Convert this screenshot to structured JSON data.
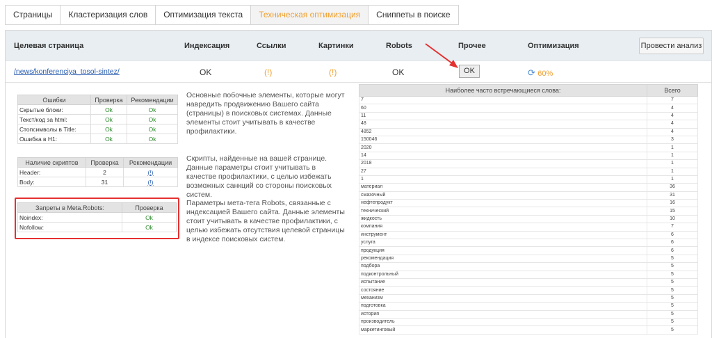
{
  "tabs": [
    {
      "label": "Страницы",
      "active": false
    },
    {
      "label": "Кластеризация слов",
      "active": false
    },
    {
      "label": "Оптимизация текста",
      "active": false
    },
    {
      "label": "Техническая оптимизация",
      "active": true
    },
    {
      "label": "Сниппеты в поиске",
      "active": false
    }
  ],
  "header": {
    "target_page": "Целевая страница",
    "indexing": "Индексация",
    "links": "Ссылки",
    "images": "Картинки",
    "robots": "Robots",
    "other": "Прочее",
    "optimization": "Оптимизация",
    "analyze_button": "Провести анализ"
  },
  "row": {
    "url": "/news/konferenciya_tosol-sintez/",
    "indexing": "OK",
    "links": "(!)",
    "images": "(!)",
    "robots": "OK",
    "other": "OK",
    "optimization": "60%"
  },
  "errors_table": {
    "headers": [
      "Ошибки",
      "Проверка",
      "Рекомендации"
    ],
    "rows": [
      [
        "Скрытые блоки:",
        "Ok",
        "Ok"
      ],
      [
        "Текст/код за html:",
        "Ok",
        "Ok"
      ],
      [
        "Стопсимволы в Title:",
        "Ok",
        "Ok"
      ],
      [
        "Ошибка в H1:",
        "Ok",
        "Ok"
      ]
    ],
    "description": "Основные побочные элементы, которые могут навредить продвижению Вашего сайта (страницы) в поисковых системах. Данные элементы стоит учитывать в качестве профилактики."
  },
  "scripts_table": {
    "headers": [
      "Наличие скриптов",
      "Проверка",
      "Рекомендации"
    ],
    "rows": [
      [
        "Header:",
        "2",
        "(!)"
      ],
      [
        "Body:",
        "31",
        "(!)"
      ]
    ],
    "description": "Скрипты, найденные на вашей странице. Данные параметры стоит учитывать в качестве профилактики, с целью избежать возможных санкций со стороны поисковых систем."
  },
  "robots_table": {
    "headers": [
      "Запреты в Meta.Robots:",
      "Проверка"
    ],
    "rows": [
      [
        "Noindex:",
        "Ok"
      ],
      [
        "Nofollow:",
        "Ok"
      ]
    ],
    "description": "Параметры мета-тега Robots, связанные с индексацией Вашего сайта. Данные элементы стоит учитывать в качестве профилактики, с целью избежать отсутствия целевой страницы в индексе поисковых систем."
  },
  "words_table": {
    "headers": [
      "Наиболее часто встречающиеся слова:",
      "Всего"
    ],
    "rows": [
      [
        "7",
        "7"
      ],
      [
        "60",
        "4"
      ],
      [
        "11",
        "4"
      ],
      [
        "48",
        "4"
      ],
      [
        "4852",
        "4"
      ],
      [
        "150046",
        "3"
      ],
      [
        "2020",
        "1"
      ],
      [
        "14",
        "1"
      ],
      [
        "2018",
        "1"
      ],
      [
        "27",
        "1"
      ],
      [
        "1",
        "1"
      ],
      [
        "материал",
        "36"
      ],
      [
        "смазочный",
        "31"
      ],
      [
        "нефтепродукт",
        "16"
      ],
      [
        "технический",
        "15"
      ],
      [
        "жидкость",
        "10"
      ],
      [
        "компания",
        "7"
      ],
      [
        "инструмент",
        "6"
      ],
      [
        "услуга",
        "6"
      ],
      [
        "продукция",
        "6"
      ],
      [
        "рекомендация",
        "5"
      ],
      [
        "подбора",
        "5"
      ],
      [
        "подконтрольный",
        "5"
      ],
      [
        "испытание",
        "5"
      ],
      [
        "состояние",
        "5"
      ],
      [
        "механизм",
        "5"
      ],
      [
        "подготовка",
        "5"
      ],
      [
        "история",
        "5"
      ],
      [
        "производитель",
        "5"
      ],
      [
        "маркетинговый",
        "5"
      ]
    ]
  }
}
